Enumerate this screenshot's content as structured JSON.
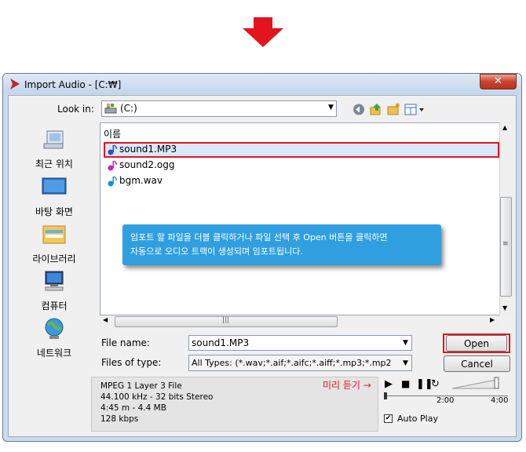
{
  "window": {
    "title": "Import Audio - [C:₩]",
    "close": "✕"
  },
  "look_in": {
    "label": "Look in:",
    "value": "(C:)"
  },
  "places": [
    "최근 위치",
    "바탕 화면",
    "라이브러리",
    "컴퓨터",
    "네트워크"
  ],
  "file_list": {
    "column_header": "이름",
    "files": [
      {
        "name": "sound1.MP3",
        "selected": true
      },
      {
        "name": "sound2.ogg",
        "selected": false
      },
      {
        "name": "bgm.wav",
        "selected": false
      }
    ]
  },
  "callout": {
    "line1": "임포트 할 파일을 더블 클릭하거나 파일 선택 후 Open 버튼을 클릭하면",
    "line2": "자동으로 오디오 트랙이 생성되며 임포트됩니다."
  },
  "file_name": {
    "label": "File name:",
    "value": "sound1.MP3"
  },
  "files_of_type": {
    "label": "Files of type:",
    "value": "All Types: (*.wav;*.aif;*.aifc;*.aiff;*.mp3;*.mp2"
  },
  "buttons": {
    "open": "Open",
    "cancel": "Cancel"
  },
  "info": {
    "line1": "MPEG 1 Layer 3 File",
    "line2": "44.100 kHz - 32 bits Stereo",
    "line3": "4:45 m - 4.4 MB",
    "line4": "128 kbps"
  },
  "preview": {
    "label": "미리 듣기 →",
    "time_mid": "2:00",
    "time_end": "4:00"
  },
  "auto_play": {
    "label": "Auto Play",
    "checked": true
  },
  "colors": {
    "highlight_red": "#e3141e",
    "callout_blue": "#2f9fe0"
  }
}
